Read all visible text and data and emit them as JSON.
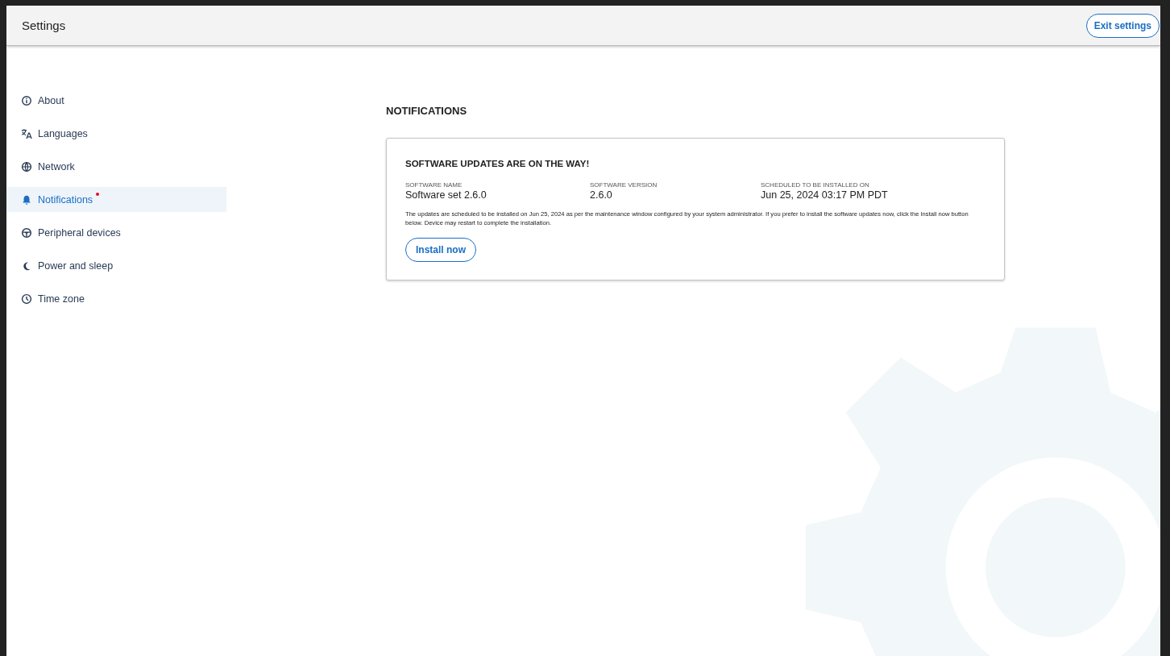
{
  "header": {
    "title": "Settings",
    "exit_button": "Exit settings"
  },
  "sidebar": {
    "items": [
      {
        "label": "About",
        "selected": false,
        "badge": false
      },
      {
        "label": "Languages",
        "selected": false,
        "badge": false
      },
      {
        "label": "Network",
        "selected": false,
        "badge": false
      },
      {
        "label": "Notifications",
        "selected": true,
        "badge": true
      },
      {
        "label": "Peripheral devices",
        "selected": false,
        "badge": false
      },
      {
        "label": "Power and sleep",
        "selected": false,
        "badge": false
      },
      {
        "label": "Time zone",
        "selected": false,
        "badge": false
      }
    ]
  },
  "section_title": "NOTIFICATIONS",
  "card": {
    "title": "SOFTWARE UPDATES ARE ON THE WAY!",
    "fields": [
      {
        "label": "SOFTWARE NAME",
        "value": "Software set 2.6.0"
      },
      {
        "label": "SOFTWARE VERSION",
        "value": "2.6.0"
      },
      {
        "label": "SCHEDULED TO BE INSTALLED ON",
        "value": "Jun 25, 2024 03:17 PM PDT"
      }
    ],
    "message": "The updates are scheduled to be installed on Jun 25, 2024 as per the maintenance window configured by your system administrator. If you prefer to install the software updates now, click the Install now button below. Device may restart to complete the installation.",
    "button": "Install now"
  }
}
